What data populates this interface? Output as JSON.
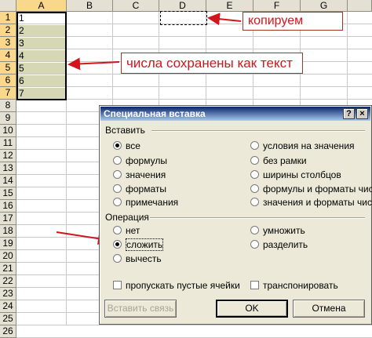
{
  "spreadsheet": {
    "columns": [
      "A",
      "B",
      "C",
      "D",
      "E",
      "F",
      "G"
    ],
    "rows": [
      "1",
      "2",
      "3",
      "4",
      "5",
      "6",
      "7",
      "8",
      "9",
      "10",
      "11",
      "12",
      "13",
      "14",
      "15",
      "16",
      "17",
      "18",
      "19",
      "20",
      "21",
      "22",
      "23",
      "24",
      "25",
      "26"
    ],
    "column_a_values": [
      "1",
      "2",
      "3",
      "4",
      "5",
      "6",
      "7"
    ]
  },
  "annotations": {
    "copy_label": "копируем",
    "text_numbers_label": "числа сохранены как текст"
  },
  "dialog": {
    "title": "Специальная вставка",
    "help_button": "?",
    "close_button": "×",
    "paste_group": {
      "label": "Вставить",
      "options_left": [
        "все",
        "формулы",
        "значения",
        "форматы",
        "примечания"
      ],
      "options_right": [
        "условия на значения",
        "без рамки",
        "ширины столбцов",
        "формулы и форматы чисел",
        "значения и форматы чисел"
      ],
      "selected": "все"
    },
    "operation_group": {
      "label": "Операция",
      "options_left": [
        "нет",
        "сложить",
        "вычесть"
      ],
      "options_right": [
        "умножить",
        "разделить"
      ],
      "selected": "сложить"
    },
    "skip_blanks_label": "пропускать пустые ячейки",
    "transpose_label": "транспонировать",
    "paste_link_button": "Вставить связь",
    "ok_button": "OK",
    "cancel_button": "Отмена"
  },
  "colors": {
    "annotation_text": "#d4141c",
    "annotation_arrow": "#d4141c",
    "selected_column_fill": "#d6d7b4",
    "header_fill": "#e4e1d4",
    "selected_header_fill": "#f9d88c",
    "dialog_title_bar": "#0a246a"
  }
}
